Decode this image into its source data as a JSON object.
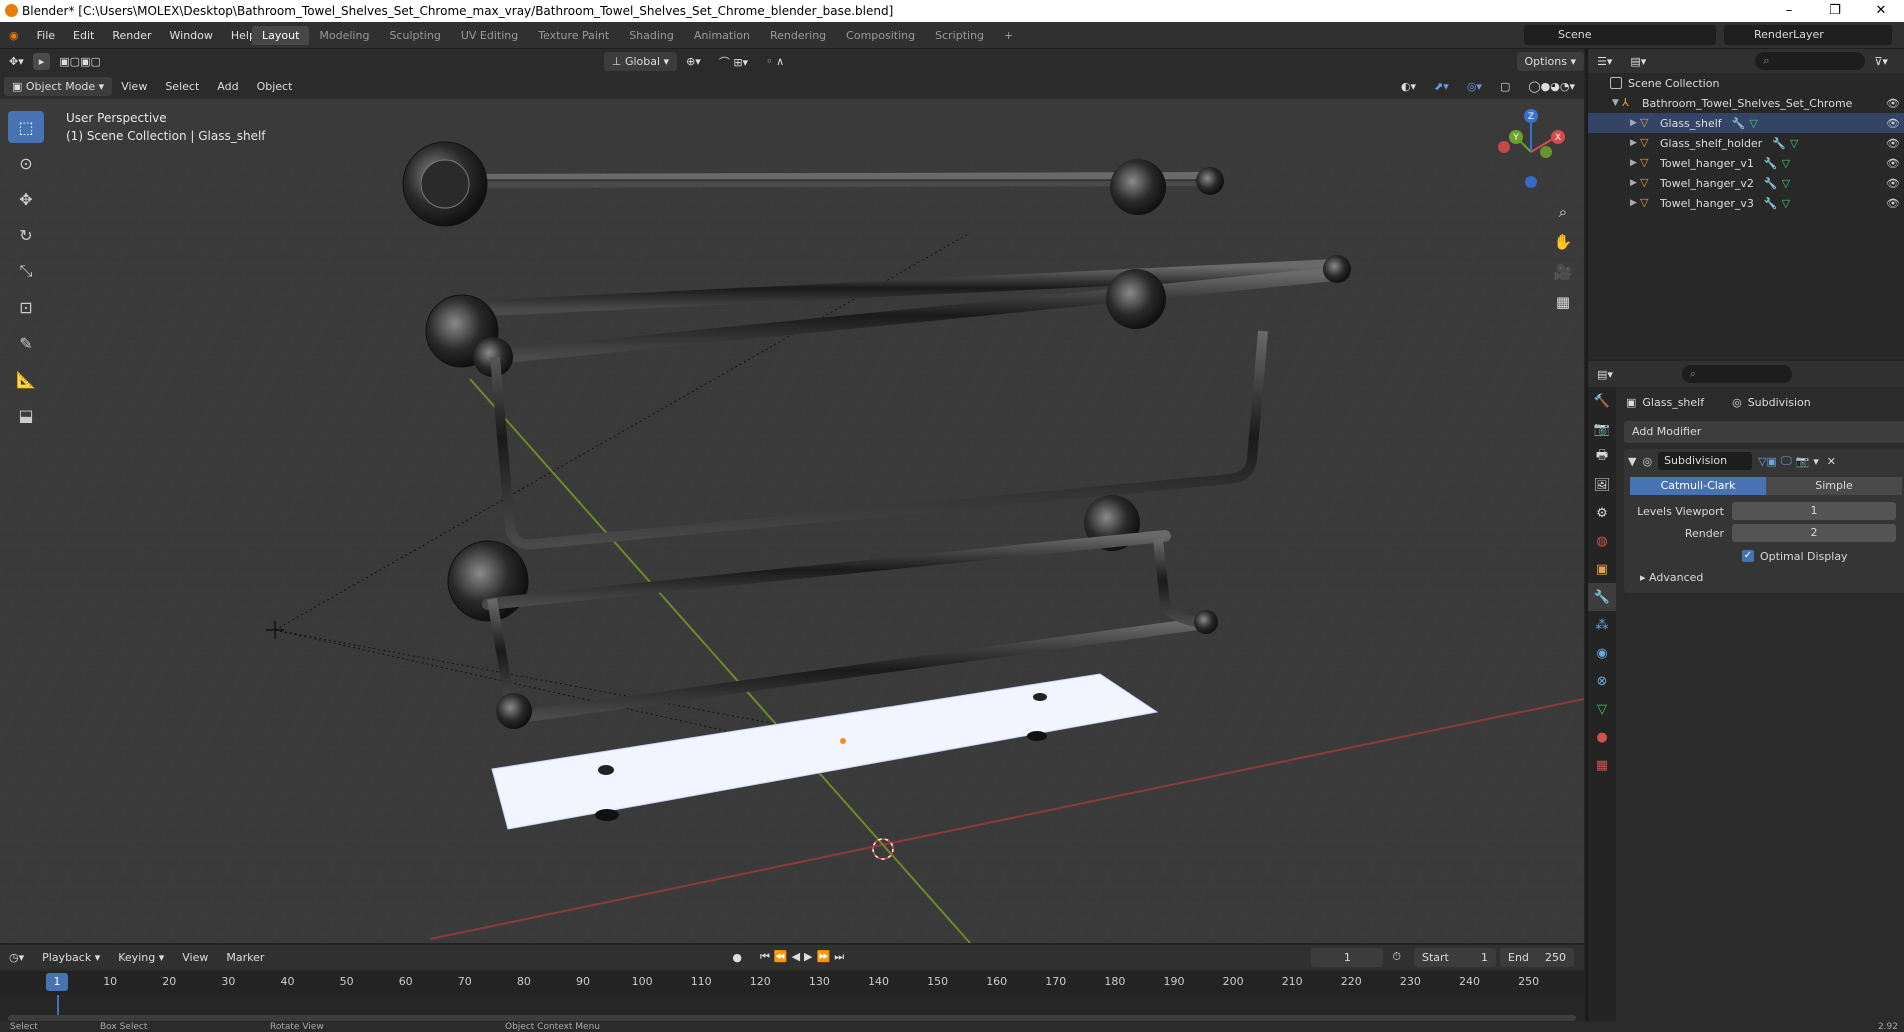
{
  "window": {
    "title": "Blender* [C:\\Users\\MOLEX\\Desktop\\Bathroom_Towel_Shelves_Set_Chrome_max_vray/Bathroom_Towel_Shelves_Set_Chrome_blender_base.blend]",
    "minimize": "–",
    "restore": "❐",
    "close": "✕"
  },
  "menu": [
    "File",
    "Edit",
    "Render",
    "Window",
    "Help"
  ],
  "workspaces": [
    "Layout",
    "Modeling",
    "Sculpting",
    "UV Editing",
    "Texture Paint",
    "Shading",
    "Animation",
    "Rendering",
    "Compositing",
    "Scripting"
  ],
  "active_workspace": "Layout",
  "scene": "Scene",
  "render_layer": "RenderLayer",
  "viewport_header": {
    "transform_orientation": "Global",
    "options": "Options",
    "mode": "Object Mode",
    "menus": [
      "View",
      "Select",
      "Add",
      "Object"
    ]
  },
  "viewport": {
    "perspective": "User Perspective",
    "collection_info": "(1) Scene Collection | Glass_shelf"
  },
  "gizmo": {
    "x": "X",
    "y": "Y",
    "z": "Z"
  },
  "outliner": {
    "root": "Scene Collection",
    "collection": "Bathroom_Towel_Shelves_Set_Chrome",
    "objects": [
      "Glass_shelf",
      "Glass_shelf_holder",
      "Towel_hanger_v1",
      "Towel_hanger_v2",
      "Towel_hanger_v3"
    ]
  },
  "properties": {
    "object": "Glass_shelf",
    "modifier_ctx": "Subdivision",
    "add_modifier": "Add Modifier",
    "modifier_name": "Subdivision",
    "mode_a": "Catmull-Clark",
    "mode_b": "Simple",
    "levels_viewport_label": "Levels Viewport",
    "levels_viewport": "1",
    "render_label": "Render",
    "render_value": "2",
    "optimal_display": "Optimal Display",
    "advanced": "Advanced"
  },
  "timeline": {
    "menus": [
      "Playback",
      "Keying",
      "View",
      "Marker"
    ],
    "current_frame": "1",
    "start_label": "Start",
    "start": "1",
    "end_label": "End",
    "end": "250",
    "ticks": [
      "10",
      "20",
      "30",
      "40",
      "50",
      "60",
      "70",
      "80",
      "90",
      "100",
      "110",
      "120",
      "130",
      "140",
      "150",
      "160",
      "170",
      "180",
      "190",
      "200",
      "210",
      "220",
      "230",
      "240",
      "250"
    ],
    "cursor": "1"
  },
  "statusbar": {
    "select": "Select",
    "box_select": "Box Select",
    "rotate_view": "Rotate View",
    "context_menu": "Object Context Menu",
    "version": "2.92"
  }
}
